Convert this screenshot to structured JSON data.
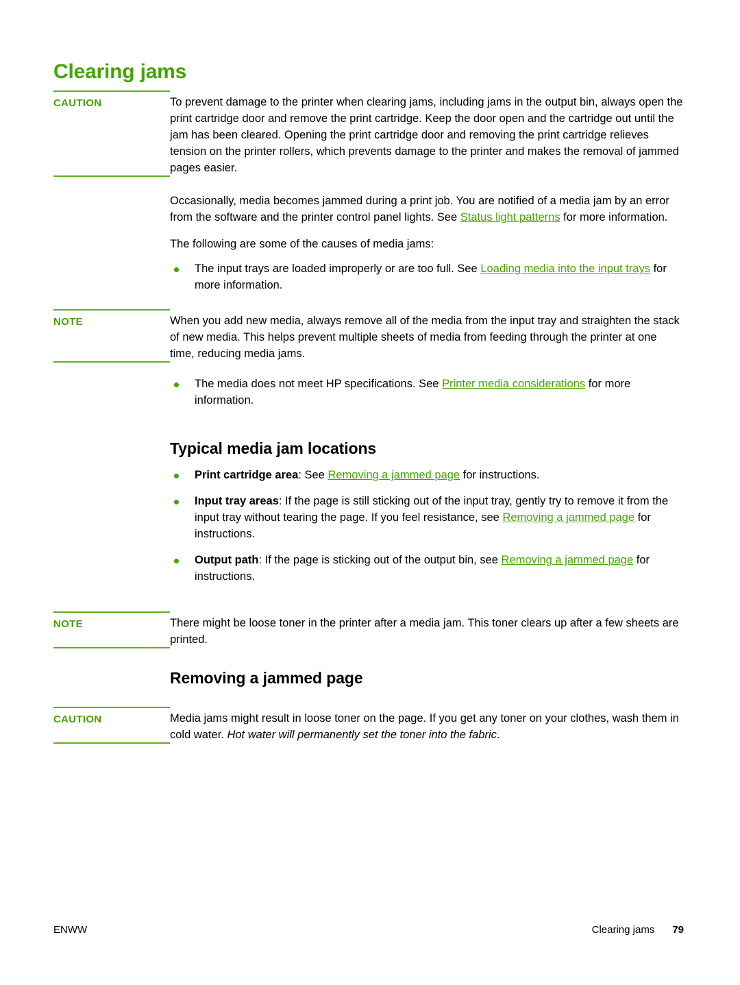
{
  "document": {
    "title": "Clearing jams",
    "title_color": "#46A302",
    "link_color": "#46A302",
    "bullet_color": "#46A302",
    "rule_color": "#5FAE1E"
  },
  "caution_1": {
    "label": "CAUTION",
    "paragraph": "To prevent damage to the printer when clearing jams, including jams in the output bin, always open the print cartridge door and remove the print cartridge. Keep the door open and the cartridge out until the jam has been cleared. Opening the print cartridge door and removing the print cartridge relieves tension on the printer rollers, which prevents damage to the printer and makes the removal of jammed pages easier."
  },
  "intro": {
    "para_1_before_link": "Occasionally, media becomes jammed during a print job. You are notified of a media jam by an error from the software and the printer control panel lights. See ",
    "para_1_link": "Status light patterns",
    "para_1_after_link": " for more information.",
    "para_2": "The following are some of the causes of media jams:"
  },
  "causes": {
    "items": [
      {
        "before_link": "The input trays are loaded improperly or are too full. See ",
        "link": "Loading media into the input trays",
        "after_link": " for more information."
      },
      {
        "before_link": "The media does not meet HP specifications. See ",
        "link": "Printer media considerations",
        "after_link": " for more information."
      }
    ]
  },
  "note_1": {
    "label": "NOTE",
    "paragraph": "When you add new media, always remove all of the media from the input tray and straighten the stack of new media. This helps prevent multiple sheets of media from feeding through the printer at one time, reducing media jams."
  },
  "section_locations": {
    "heading": "Typical media jam locations",
    "items": [
      {
        "lead": "Print cartridge area",
        "before_link": ": See ",
        "link": "Removing a jammed page",
        "after_link": " for instructions."
      },
      {
        "lead": "Input tray areas",
        "before_link": ": If the page is still sticking out of the input tray, gently try to remove it from the input tray without tearing the page. If you feel resistance, see ",
        "link": "Removing a jammed page",
        "after_link": " for instructions."
      },
      {
        "lead": "Output path",
        "before_link": ": If the page is sticking out of the output bin, see ",
        "link": "Removing a jammed page",
        "after_link": " for instructions."
      }
    ]
  },
  "note_2": {
    "label": "NOTE",
    "paragraph": "There might be loose toner in the printer after a media jam. This toner clears up after a few sheets are printed."
  },
  "section_removing": {
    "heading": "Removing a jammed page"
  },
  "caution_2": {
    "label": "CAUTION",
    "text_plain": "Media jams might result in loose toner on the page. If you get any toner on your clothes, wash them in cold water. ",
    "text_italic": "Hot water will permanently set the toner into the fabric",
    "text_end": "."
  },
  "footer": {
    "left": "ENWW",
    "chapter": "Clearing jams",
    "page_number": "79"
  }
}
